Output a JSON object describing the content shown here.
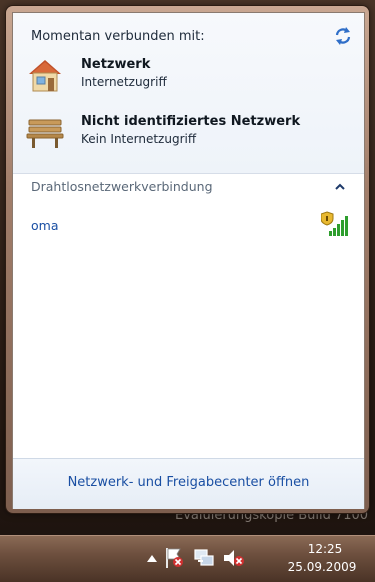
{
  "desktop": {
    "watermark": "Evaluierungskopie Build 7100"
  },
  "flyout": {
    "current_label": "Momentan verbunden mit:",
    "connections": [
      {
        "name": "Netzwerk",
        "status": "Internetzugriff",
        "icon": "home-network-icon"
      },
      {
        "name": "Nicht identifiziertes Netzwerk",
        "status": "Kein Internetzugriff",
        "icon": "public-network-icon"
      }
    ],
    "section_label": "Drahtlosnetzwerkverbindung",
    "wireless_networks": [
      {
        "name": "oma",
        "icon": "secured-signal-icon"
      }
    ],
    "footer_link": "Netzwerk- und Freigabecenter öffnen"
  },
  "taskbar": {
    "clock_time": "12:25",
    "clock_date": "25.09.2009"
  },
  "colors": {
    "link": "#1a4fa3",
    "signal": "#2e9e2e"
  }
}
